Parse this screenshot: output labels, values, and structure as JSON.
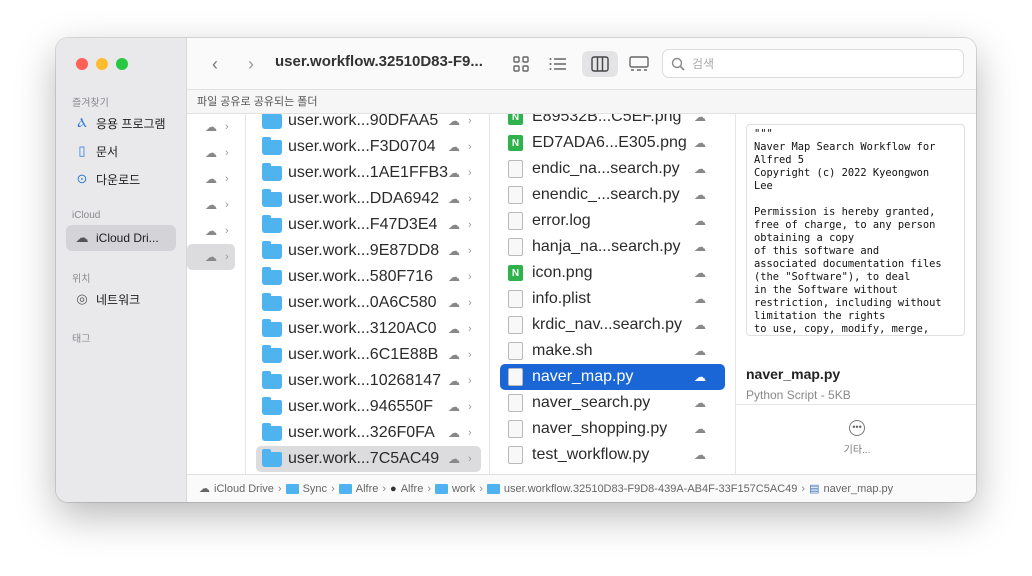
{
  "window": {
    "title": "user.workflow.32510D83-F9..."
  },
  "colors": {
    "accent": "#1a66d6",
    "folder": "#4fb3f0",
    "close": "#fe5f57",
    "minimize": "#febc2e",
    "zoom": "#28c840"
  },
  "sidebar": {
    "favorites_title": "즐겨찾기",
    "favorites": [
      {
        "icon": "applications-icon",
        "label": "응용 프로그램"
      },
      {
        "icon": "document-icon",
        "label": "문서"
      },
      {
        "icon": "download-icon",
        "label": "다운로드"
      }
    ],
    "icloud_title": "iCloud",
    "icloud_items": [
      {
        "icon": "icloud-icon",
        "label": "iCloud Dri..."
      }
    ],
    "locations_title": "위치",
    "locations": [
      {
        "icon": "network-icon",
        "label": "네트워크"
      }
    ],
    "tags_title": "태그"
  },
  "toolbar": {
    "search_placeholder": "검색"
  },
  "shared_bar": {
    "label": "파일 공유로 공유되는 폴더"
  },
  "column1_count": 6,
  "column2": {
    "folders": [
      "user.work...90DFAA5",
      "user.work...F3D0704",
      "user.work...1AE1FFB3",
      "user.work...DDA6942",
      "user.work...F47D3E4",
      "user.work...9E87DD8",
      "user.work...580F716",
      "user.work...0A6C580",
      "user.work...3120AC0",
      "user.work...6C1E88B",
      "user.work...10268147",
      "user.work...946550F",
      "user.work...326F0FA",
      "user.work...7C5AC49"
    ]
  },
  "column3": {
    "files": [
      {
        "name": "E89532B...C5EF.png",
        "type": "png"
      },
      {
        "name": "ED7ADA6...E305.png",
        "type": "png"
      },
      {
        "name": "endic_na...search.py",
        "type": "doc"
      },
      {
        "name": "enendic_...search.py",
        "type": "doc"
      },
      {
        "name": "error.log",
        "type": "doc"
      },
      {
        "name": "hanja_na...search.py",
        "type": "doc"
      },
      {
        "name": "icon.png",
        "type": "png"
      },
      {
        "name": "info.plist",
        "type": "doc"
      },
      {
        "name": "krdic_nav...search.py",
        "type": "doc"
      },
      {
        "name": "make.sh",
        "type": "doc"
      },
      {
        "name": "naver_map.py",
        "type": "doc"
      },
      {
        "name": "naver_search.py",
        "type": "doc"
      },
      {
        "name": "naver_shopping.py",
        "type": "doc"
      },
      {
        "name": "test_workflow.py",
        "type": "doc"
      }
    ]
  },
  "preview": {
    "code": "\"\"\"\nNaver Map Search Workflow for\nAlfred 5\nCopyright (c) 2022 Kyeongwon\nLee\n\nPermission is hereby granted,\nfree of charge, to any person\nobtaining a copy\nof this software and\nassociated documentation files\n(the \"Software\"), to deal\nin the Software without\nrestriction, including without\nlimitation the rights\nto use, copy, modify, merge,\npublish, distribute, sublicense,",
    "file_name": "naver_map.py",
    "file_kind": "Python Script - 5KB",
    "more_label": "기타..."
  },
  "pathbar": {
    "segments": [
      {
        "label": "iCloud Drive",
        "icon": "icloud-icon"
      },
      {
        "label": "Sync",
        "icon": "folder-icon"
      },
      {
        "label": "Alfre",
        "icon": "folder-icon"
      },
      {
        "label": "Alfre",
        "icon": "alfred-icon"
      },
      {
        "label": "work",
        "icon": "folder-icon"
      },
      {
        "label": "user.workflow.32510D83-F9D8-439A-AB4F-33F157C5AC49",
        "icon": "folder-icon"
      },
      {
        "label": "naver_map.py",
        "icon": "python-file-icon"
      }
    ]
  }
}
